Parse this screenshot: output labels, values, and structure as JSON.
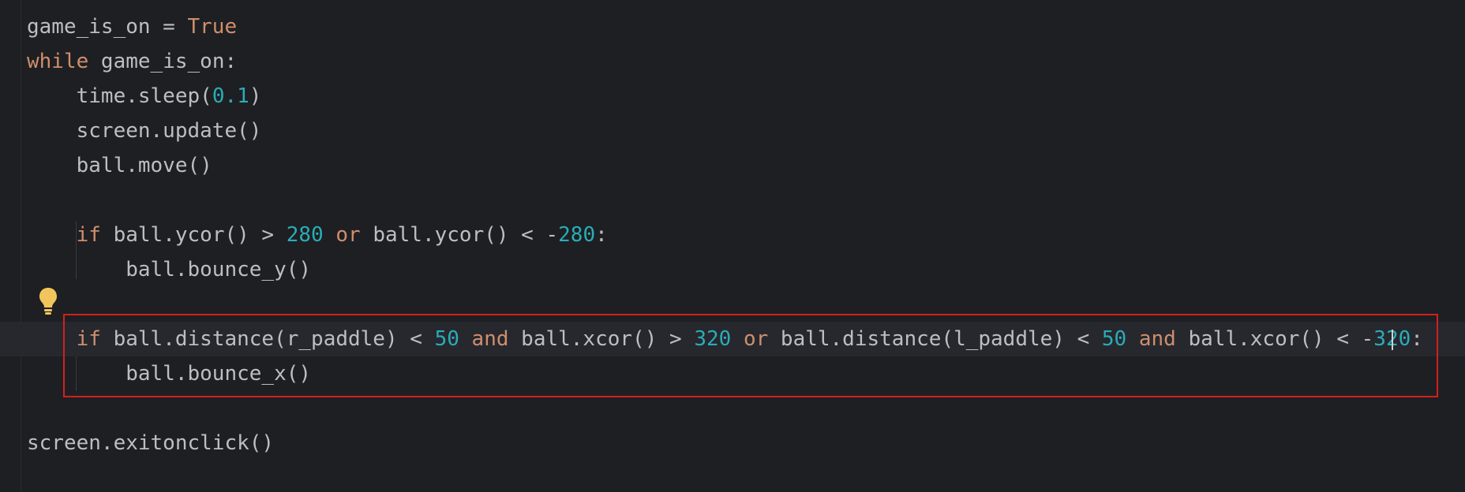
{
  "code_lines": [
    {
      "tokens": [
        {
          "t": "game_is_on = ",
          "c": "txt"
        },
        {
          "t": "True",
          "c": "kw"
        }
      ]
    },
    {
      "tokens": [
        {
          "t": "while",
          "c": "kw"
        },
        {
          "t": " game_is_on:",
          "c": "txt"
        }
      ]
    },
    {
      "tokens": [
        {
          "t": "    time.sleep(",
          "c": "txt"
        },
        {
          "t": "0.1",
          "c": "num"
        },
        {
          "t": ")",
          "c": "txt"
        }
      ]
    },
    {
      "tokens": [
        {
          "t": "    screen.update()",
          "c": "txt"
        }
      ]
    },
    {
      "tokens": [
        {
          "t": "    ball.move()",
          "c": "txt"
        }
      ]
    },
    {
      "tokens": []
    },
    {
      "tokens": [
        {
          "t": "    ",
          "c": "txt"
        },
        {
          "t": "if",
          "c": "kw"
        },
        {
          "t": " ball.ycor() > ",
          "c": "txt"
        },
        {
          "t": "280",
          "c": "num"
        },
        {
          "t": " ",
          "c": "txt"
        },
        {
          "t": "or",
          "c": "kw"
        },
        {
          "t": " ball.ycor() < -",
          "c": "txt"
        },
        {
          "t": "280",
          "c": "num"
        },
        {
          "t": ":",
          "c": "txt"
        }
      ]
    },
    {
      "tokens": [
        {
          "t": "        ball.bounce_y()",
          "c": "txt"
        }
      ]
    },
    {
      "tokens": []
    },
    {
      "tokens": [
        {
          "t": "    ",
          "c": "txt"
        },
        {
          "t": "if",
          "c": "kw"
        },
        {
          "t": " ball.distance(r_paddle) < ",
          "c": "txt"
        },
        {
          "t": "50",
          "c": "num"
        },
        {
          "t": " ",
          "c": "txt"
        },
        {
          "t": "and",
          "c": "kw"
        },
        {
          "t": " ball.xcor() > ",
          "c": "txt"
        },
        {
          "t": "320",
          "c": "num"
        },
        {
          "t": " ",
          "c": "txt"
        },
        {
          "t": "or",
          "c": "kw"
        },
        {
          "t": " ball.distance(l_paddle) < ",
          "c": "txt"
        },
        {
          "t": "50",
          "c": "num"
        },
        {
          "t": " ",
          "c": "txt"
        },
        {
          "t": "and",
          "c": "kw"
        },
        {
          "t": " ball.xcor() < -",
          "c": "txt"
        },
        {
          "t": "320",
          "c": "num"
        },
        {
          "t": ":",
          "c": "txt"
        }
      ]
    },
    {
      "tokens": [
        {
          "t": "        ball.bounce_x()",
          "c": "txt"
        }
      ]
    },
    {
      "tokens": []
    },
    {
      "tokens": [
        {
          "t": "screen.exitonclick()",
          "c": "txt"
        }
      ]
    }
  ],
  "icons": {
    "intention_bulb": "lightbulb-icon"
  },
  "colors": {
    "background": "#1e1f22",
    "keyword": "#cf8e6d",
    "number": "#2aacb8",
    "text": "#bcbec4",
    "highlight_border": "#d41f1f"
  }
}
